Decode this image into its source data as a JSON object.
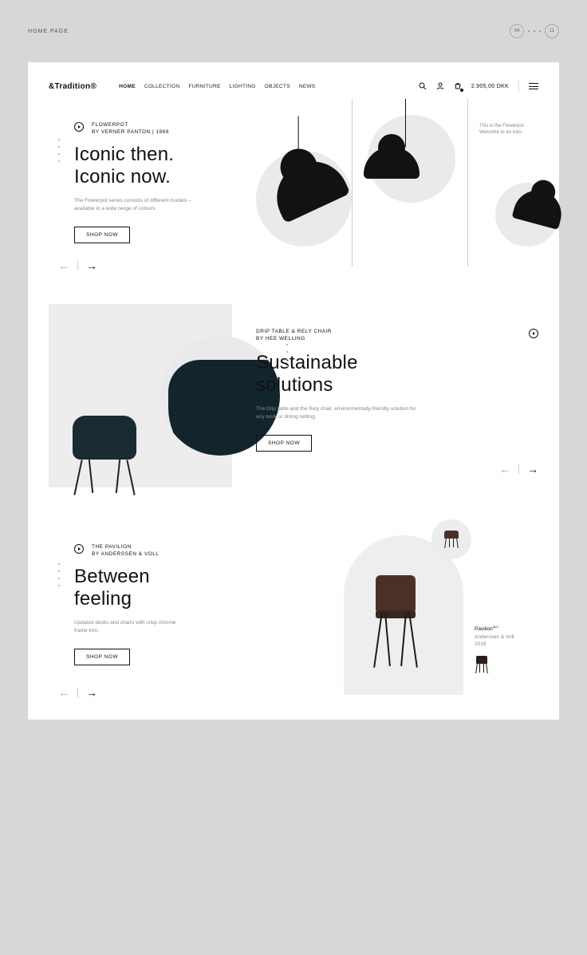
{
  "meta": {
    "label": "HOME PAGE",
    "current": "04",
    "total": "11"
  },
  "brand": "&Tradition®",
  "nav": {
    "items": [
      "HOME",
      "COLLECTION",
      "FURNITURE",
      "LIGHTING",
      "OBJECTS",
      "NEWS"
    ],
    "active_index": 0,
    "cart_amount": "2.905,00 DKK"
  },
  "hero": {
    "kicker_line1": "FLOWERPOT",
    "kicker_line2": "BY VERNER PANTON | 1968",
    "headline_line1": "Iconic then.",
    "headline_line2": "Iconic now.",
    "body": "The Flowerpot series consists of different models – available in a wide range of colours.",
    "cta": "SHOP NOW",
    "note_line1": "This is the Flowerpot.",
    "note_line2": "Welcome to an icon."
  },
  "sec2": {
    "kicker_line1": "DRIP TABLE & RELY CHAIR",
    "kicker_line2": "BY HEE WELLING",
    "headline_line1": "Sustainable",
    "headline_line2": "solutions",
    "body": "The Drip table and the Rely chair, environmentally-friendly solution for any work or dining setting.",
    "cta": "SHOP NOW"
  },
  "sec3": {
    "kicker_line1": "THE PAVILION",
    "kicker_line2": "BY ANDERSSEN & VOLL",
    "headline_line1": "Between",
    "headline_line2": "feeling",
    "body": "Updated desks and chairs with crisp chrome frame trim.",
    "cta": "SHOP NOW",
    "meta_title": "Pavilion",
    "meta_sup": "AV1",
    "meta_by": "Anderssen & Voll",
    "meta_year": "2018"
  }
}
